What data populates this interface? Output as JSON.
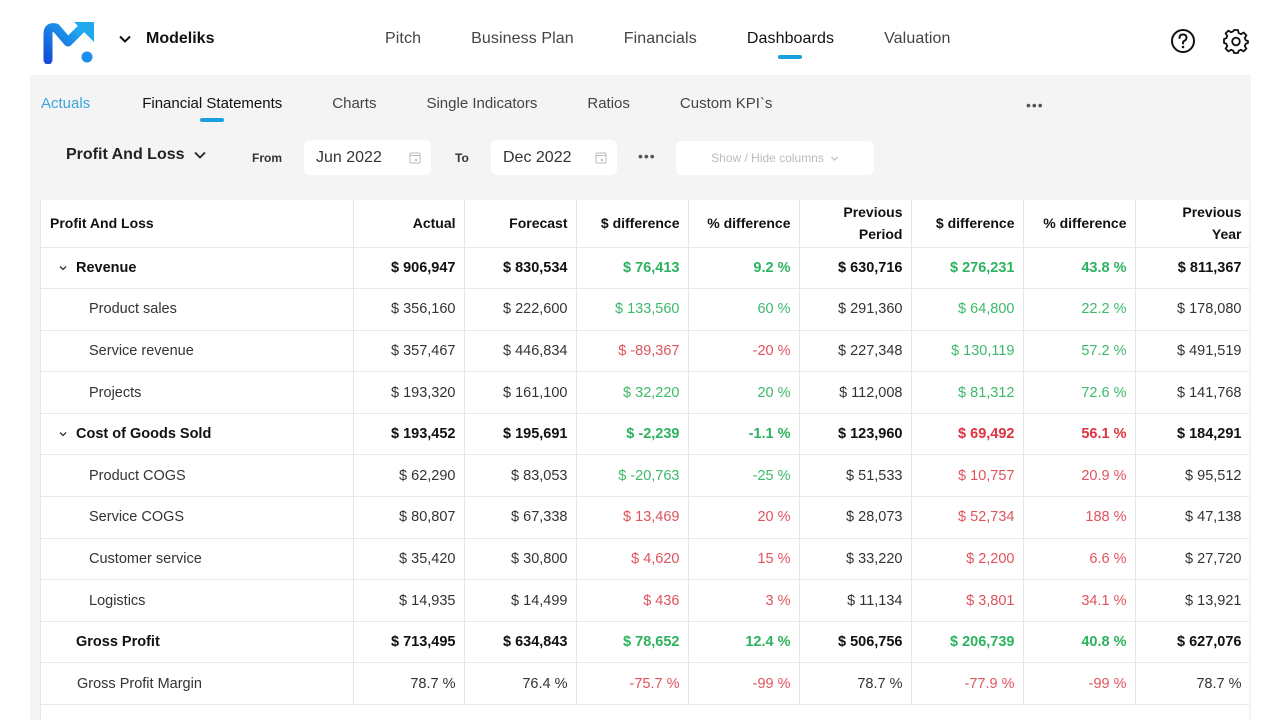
{
  "app": {
    "org_name": "Modeliks",
    "main_nav": [
      "Pitch",
      "Business Plan",
      "Financials",
      "Dashboards",
      "Valuation"
    ],
    "main_nav_active": "Dashboards",
    "accent_color": "#1aa0e0",
    "icons": {
      "help": "question-circle-icon",
      "settings": "gear-icon",
      "logo": "modeliks-logo"
    }
  },
  "subtabs": {
    "items": [
      "Actuals",
      "Financial Statements",
      "Charts",
      "Single Indicators",
      "Ratios",
      "Custom KPI`s"
    ],
    "active": "Financial Statements",
    "more_label": "•••"
  },
  "filters": {
    "statement": "Profit And Loss",
    "from_label": "From",
    "from_value": "Jun 2022",
    "to_label": "To",
    "to_value": "Dec 2022",
    "more_label": "•••",
    "columns_button": "Show / Hide columns"
  },
  "table": {
    "headers": [
      "Profit And Loss",
      "Actual",
      "Forecast",
      "$ difference",
      "% difference",
      "Previous Period",
      "$ difference",
      "% difference",
      "Previous Year"
    ],
    "header_lines": {
      "previous_period": [
        "Previous",
        "Period"
      ],
      "previous_year": [
        "Previous",
        "Year"
      ]
    },
    "rows": [
      {
        "name": "Revenue",
        "type": "group",
        "expandable": true,
        "cells": [
          "$ 906,947",
          "$ 830,534",
          "$ 76,413",
          "9.2 %",
          "$ 630,716",
          "$ 276,231",
          "43.8 %",
          "$ 811,367"
        ],
        "status": [
          "plain",
          "plain",
          "pos",
          "pos",
          "plain",
          "pos",
          "pos",
          "plain"
        ]
      },
      {
        "name": "Product sales",
        "type": "child",
        "cells": [
          "$ 356,160",
          "$ 222,600",
          "$ 133,560",
          "60 %",
          "$ 291,360",
          "$ 64,800",
          "22.2 %",
          "$ 178,080"
        ],
        "status": [
          "plain",
          "plain",
          "pos",
          "pos",
          "plain",
          "pos",
          "pos",
          "plain"
        ]
      },
      {
        "name": "Service revenue",
        "type": "child",
        "cells": [
          "$ 357,467",
          "$ 446,834",
          "$ -89,367",
          "-20 %",
          "$ 227,348",
          "$ 130,119",
          "57.2 %",
          "$ 491,519"
        ],
        "status": [
          "plain",
          "plain",
          "neg",
          "neg",
          "plain",
          "pos",
          "pos",
          "plain"
        ]
      },
      {
        "name": "Projects",
        "type": "child",
        "cells": [
          "$ 193,320",
          "$ 161,100",
          "$ 32,220",
          "20 %",
          "$ 112,008",
          "$ 81,312",
          "72.6 %",
          "$ 141,768"
        ],
        "status": [
          "plain",
          "plain",
          "pos",
          "pos",
          "plain",
          "pos",
          "pos",
          "plain"
        ]
      },
      {
        "name": "Cost of Goods Sold",
        "type": "group",
        "expandable": true,
        "cells": [
          "$ 193,452",
          "$ 195,691",
          "$ -2,239",
          "-1.1 %",
          "$ 123,960",
          "$ 69,492",
          "56.1 %",
          "$ 184,291"
        ],
        "status": [
          "plain",
          "plain",
          "pos",
          "pos",
          "plain",
          "neg",
          "neg",
          "plain"
        ]
      },
      {
        "name": "Product COGS",
        "type": "child",
        "cells": [
          "$ 62,290",
          "$ 83,053",
          "$ -20,763",
          "-25 %",
          "$ 51,533",
          "$ 10,757",
          "20.9 %",
          "$ 95,512"
        ],
        "status": [
          "plain",
          "plain",
          "pos",
          "pos",
          "plain",
          "neg",
          "neg",
          "plain"
        ]
      },
      {
        "name": "Service COGS",
        "type": "child",
        "cells": [
          "$ 80,807",
          "$ 67,338",
          "$ 13,469",
          "20 %",
          "$ 28,073",
          "$ 52,734",
          "188 %",
          "$ 47,138"
        ],
        "status": [
          "plain",
          "plain",
          "neg",
          "neg",
          "plain",
          "neg",
          "neg",
          "plain"
        ]
      },
      {
        "name": "Customer service",
        "type": "child",
        "cells": [
          "$ 35,420",
          "$ 30,800",
          "$ 4,620",
          "15 %",
          "$ 33,220",
          "$ 2,200",
          "6.6 %",
          "$ 27,720"
        ],
        "status": [
          "plain",
          "plain",
          "neg",
          "neg",
          "plain",
          "neg",
          "neg",
          "plain"
        ]
      },
      {
        "name": "Logistics",
        "type": "child",
        "cells": [
          "$ 14,935",
          "$ 14,499",
          "$ 436",
          "3 %",
          "$ 11,134",
          "$ 3,801",
          "34.1 %",
          "$ 13,921"
        ],
        "status": [
          "plain",
          "plain",
          "neg",
          "neg",
          "plain",
          "neg",
          "neg",
          "plain"
        ]
      },
      {
        "name": "Gross Profit",
        "type": "total",
        "cells": [
          "$ 713,495",
          "$ 634,843",
          "$ 78,652",
          "12.4 %",
          "$ 506,756",
          "$ 206,739",
          "40.8 %",
          "$ 627,076"
        ],
        "status": [
          "plain",
          "plain",
          "pos",
          "pos",
          "plain",
          "pos",
          "pos",
          "plain"
        ]
      },
      {
        "name": "Gross Profit Margin",
        "type": "ratio",
        "cells": [
          "78.7 %",
          "76.4 %",
          "-75.7 %",
          "-99 %",
          "78.7 %",
          "-77.9 %",
          "-99 %",
          "78.7 %"
        ],
        "status": [
          "plain",
          "plain",
          "neg",
          "neg",
          "plain",
          "neg",
          "neg",
          "plain"
        ]
      }
    ],
    "colors": {
      "positive": "#3cb96a",
      "negative": "#e0535c"
    }
  }
}
